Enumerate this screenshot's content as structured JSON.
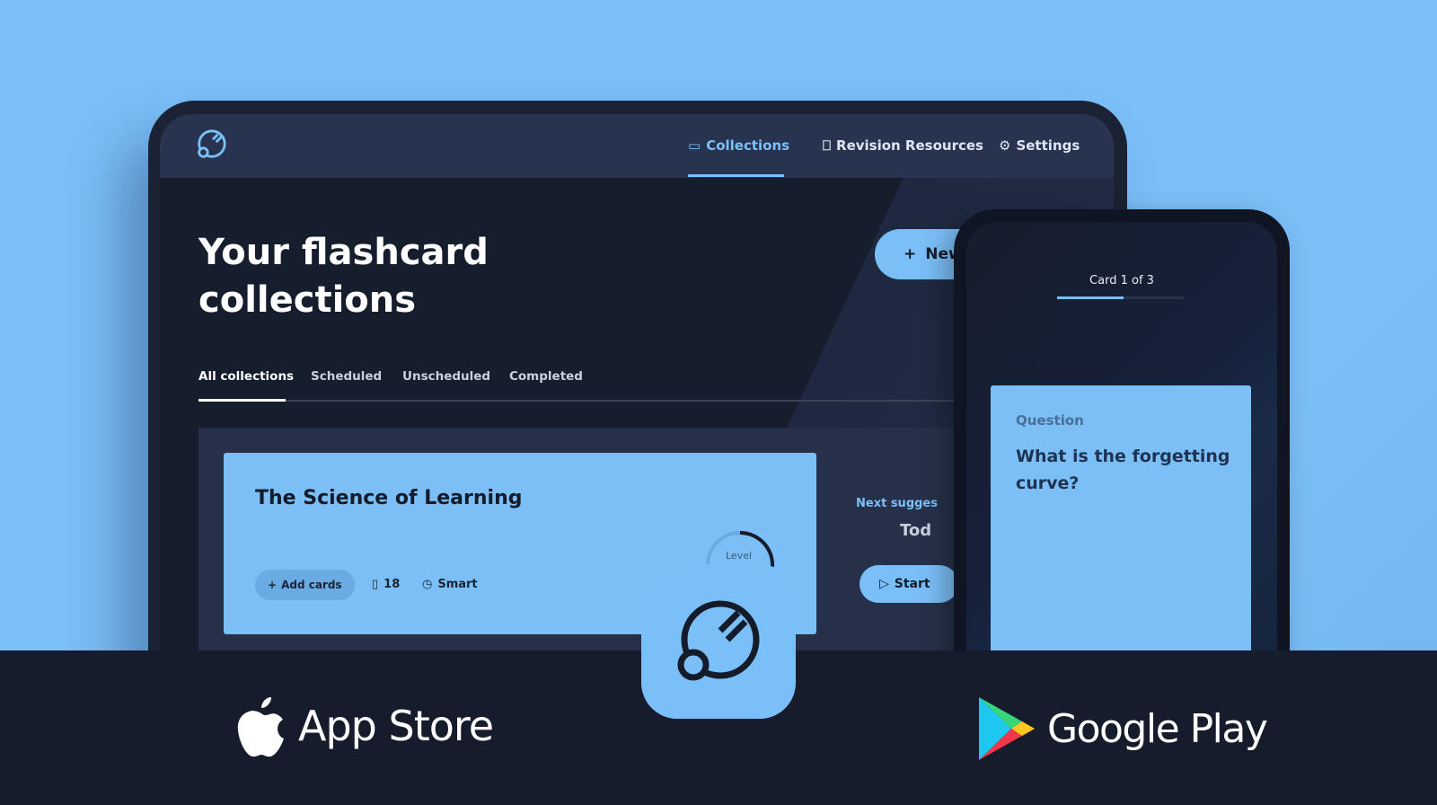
{
  "colors": {
    "accent": "#7bbff8",
    "background": "#7bbff8",
    "dark": "#161c2c"
  },
  "nav": {
    "logo": "brain-logo-icon",
    "items": [
      {
        "label": "Collections",
        "icon": "folder-icon",
        "active": true
      },
      {
        "label": "Revision Resources",
        "icon": "bookmark-icon"
      },
      {
        "label": "Settings",
        "icon": "gear-icon"
      }
    ]
  },
  "main": {
    "title_line1": "Your flashcard",
    "title_line2": "collections",
    "new_button": "New",
    "tabs": [
      {
        "label": "All collections",
        "active": true
      },
      {
        "label": "Scheduled"
      },
      {
        "label": "Unscheduled"
      },
      {
        "label": "Completed"
      }
    ],
    "collection": {
      "title": "The Science of Learning",
      "add_cards": "Add cards",
      "card_count": "18",
      "mode": "Smart",
      "level_label": "Level"
    },
    "next_suggested": "Next sugges",
    "next_date": "Tod",
    "start_button": "Start"
  },
  "phone": {
    "progress_label": "Card 1 of 3",
    "progress": 0.52,
    "question_label": "Question",
    "question": "What is the forgetting curve?"
  },
  "stores": {
    "apple": "App Store",
    "google": "Google Play"
  }
}
